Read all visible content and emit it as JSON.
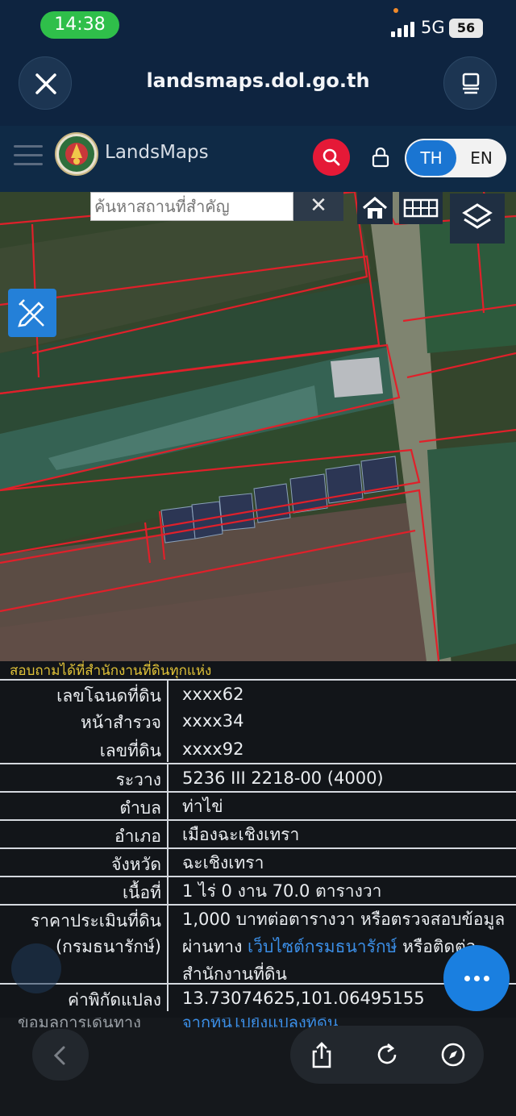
{
  "status": {
    "time": "14:38",
    "network": "5G",
    "battery": "56"
  },
  "browser": {
    "url": "landsmaps.dol.go.th"
  },
  "app": {
    "title": "LandsMaps",
    "lang_th": "TH",
    "lang_en": "EN"
  },
  "map": {
    "search_placeholder": "ค้นหาสถานที่สำคัญ",
    "clear_label": "✕"
  },
  "info": {
    "note": "สอบถามได้ที่สำนักงานที่ดินทุกแห่ง",
    "rows": [
      {
        "label": "เลขโฉนดที่ดิน",
        "value": "xxxx62"
      },
      {
        "label": "หน้าสำรวจ",
        "value": "xxxx34"
      },
      {
        "label": "เลขที่ดิน",
        "value": "xxxx92"
      },
      {
        "label": "ระวาง",
        "value": "5236 III 2218-00 (4000)"
      },
      {
        "label": "ตำบล",
        "value": "ท่าไข่"
      },
      {
        "label": "อำเภอ",
        "value": "เมืองฉะเชิงเทรา"
      },
      {
        "label": "จังหวัด",
        "value": "ฉะเชิงเทรา"
      },
      {
        "label": "เนื้อที่",
        "value": "1 ไร่ 0 งาน 70.0 ตารางวา"
      }
    ],
    "price": {
      "label_1": "ราคาประเมินที่ดิน",
      "label_2": "(กรมธนารักษ์)",
      "line_1": "1,000 บาทต่อตารางวา หรือตรวจสอบข้อมูล",
      "line_2_pre": "ผ่านทาง ",
      "line_2_link": "เว็บไซต์กรมธนารักษ์",
      "line_2_post": " หรือติดต่อ",
      "line_3": "สำนักงานที่ดิน"
    },
    "coords": {
      "label": "ค่าพิกัดแปลง",
      "value": "13.73074625,101.06495155"
    },
    "route": {
      "label": "ข้อมูลการเดินทาง",
      "value": "จากที่นี่ไปยังแปลงที่ดิน"
    }
  }
}
